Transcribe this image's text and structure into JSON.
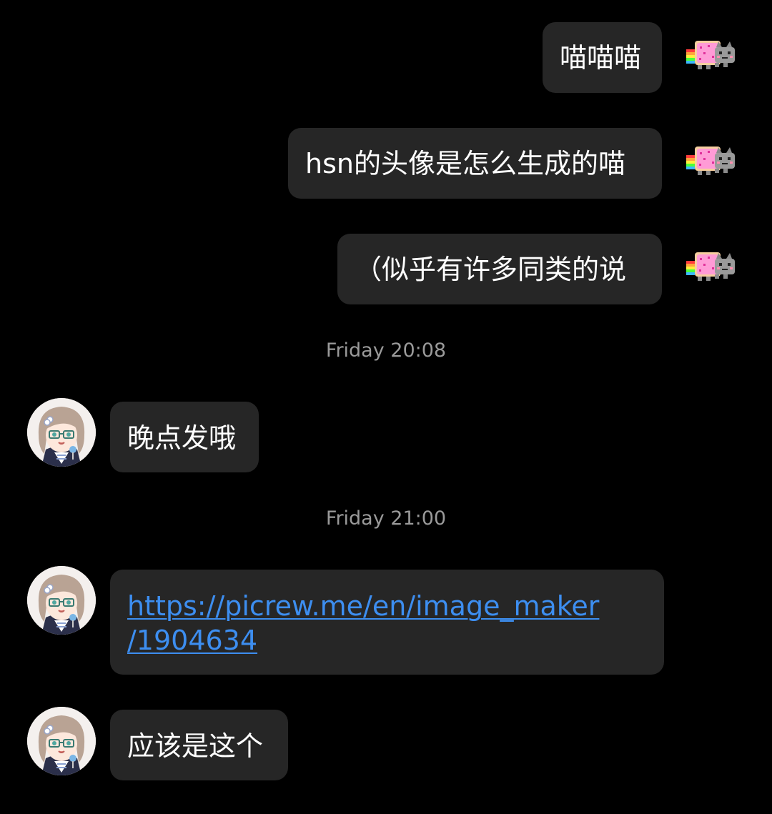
{
  "messages": [
    {
      "side": "out",
      "text": "喵喵喵"
    },
    {
      "side": "out",
      "text": "hsn的头像是怎么生成的喵"
    },
    {
      "side": "out",
      "text": "（似乎有许多同类的说"
    },
    {
      "side": "in",
      "text": "晚点发哦"
    },
    {
      "side": "in",
      "link_line1": "https://picrew.me/en/image_maker",
      "link_line2": "/1904634"
    },
    {
      "side": "in",
      "text": "应该是这个"
    }
  ],
  "timestamps": [
    "Friday 20:08",
    "Friday 21:00"
  ],
  "icons": {
    "outgoing_avatar": "nyan-cat-icon",
    "incoming_avatar": "anime-girl-avatar"
  },
  "colors": {
    "background": "#000000",
    "bubble": "#262626",
    "text": "#ffffff",
    "timestamp": "#9a9a9a",
    "link": "#3d8ef0"
  }
}
